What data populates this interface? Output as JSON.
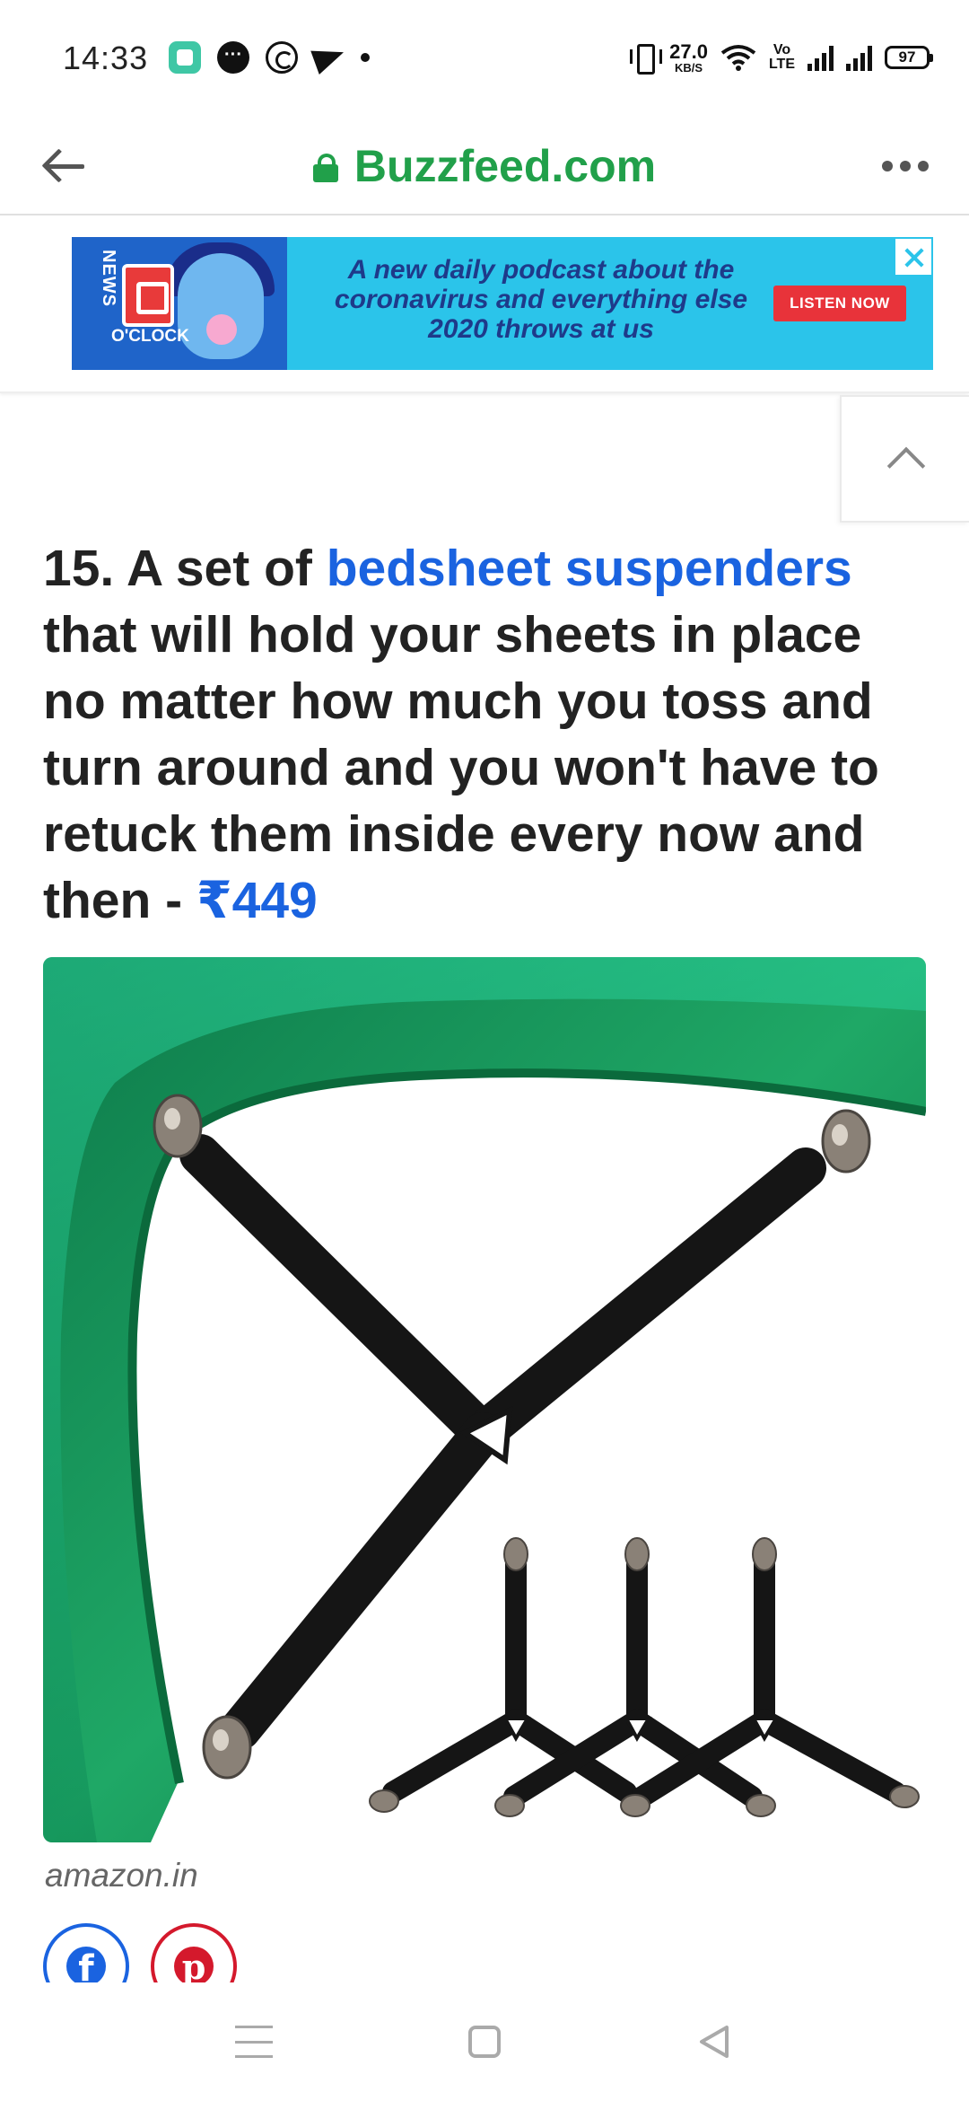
{
  "status_bar": {
    "time": "14:33",
    "net_speed": "27.0",
    "net_unit": "KB/S",
    "volte": "Vo\nLTE",
    "battery": "97",
    "icons": [
      "app-icon",
      "messages-icon",
      "whatsapp-icon",
      "telegram-icon",
      "notification-dot-icon",
      "vibrate-icon",
      "wifi-icon",
      "signal-icon",
      "signal-icon",
      "battery-icon"
    ]
  },
  "browser": {
    "url": "Buzzfeed.com",
    "back_icon": "arrow-left-icon",
    "menu_icon": "more-dots-icon",
    "secure_icon": "lock-icon",
    "url_color": "#21a04a"
  },
  "ad": {
    "brand_line1": "NEWS",
    "brand_line2": "O'CLOCK",
    "text": "A new daily podcast about the coronavirus and everything else 2020 throws at us",
    "cta": "LISTEN NOW",
    "background_color": "#2bc4ea",
    "cta_color": "#e8333a"
  },
  "article": {
    "heading_prefix": "15. A set of ",
    "heading_link": "bedsheet suspenders",
    "heading_suffix": " that will hold your sheets in place no matter how much you toss and turn around and you won't have to retuck them inside every now and then - ",
    "price": "₹449",
    "link_color": "#1a63e0",
    "image_alt": "Green fitted bedsheet held by black elastic suspender straps with metal clips",
    "source": "amazon.in"
  },
  "share": {
    "facebook_icon": "facebook-icon",
    "pinterest_icon": "pinterest-icon",
    "facebook_glyph": "f",
    "pinterest_glyph": "p"
  },
  "nav": {
    "icons": [
      "recents-icon",
      "home-icon",
      "back-triangle-icon"
    ]
  }
}
